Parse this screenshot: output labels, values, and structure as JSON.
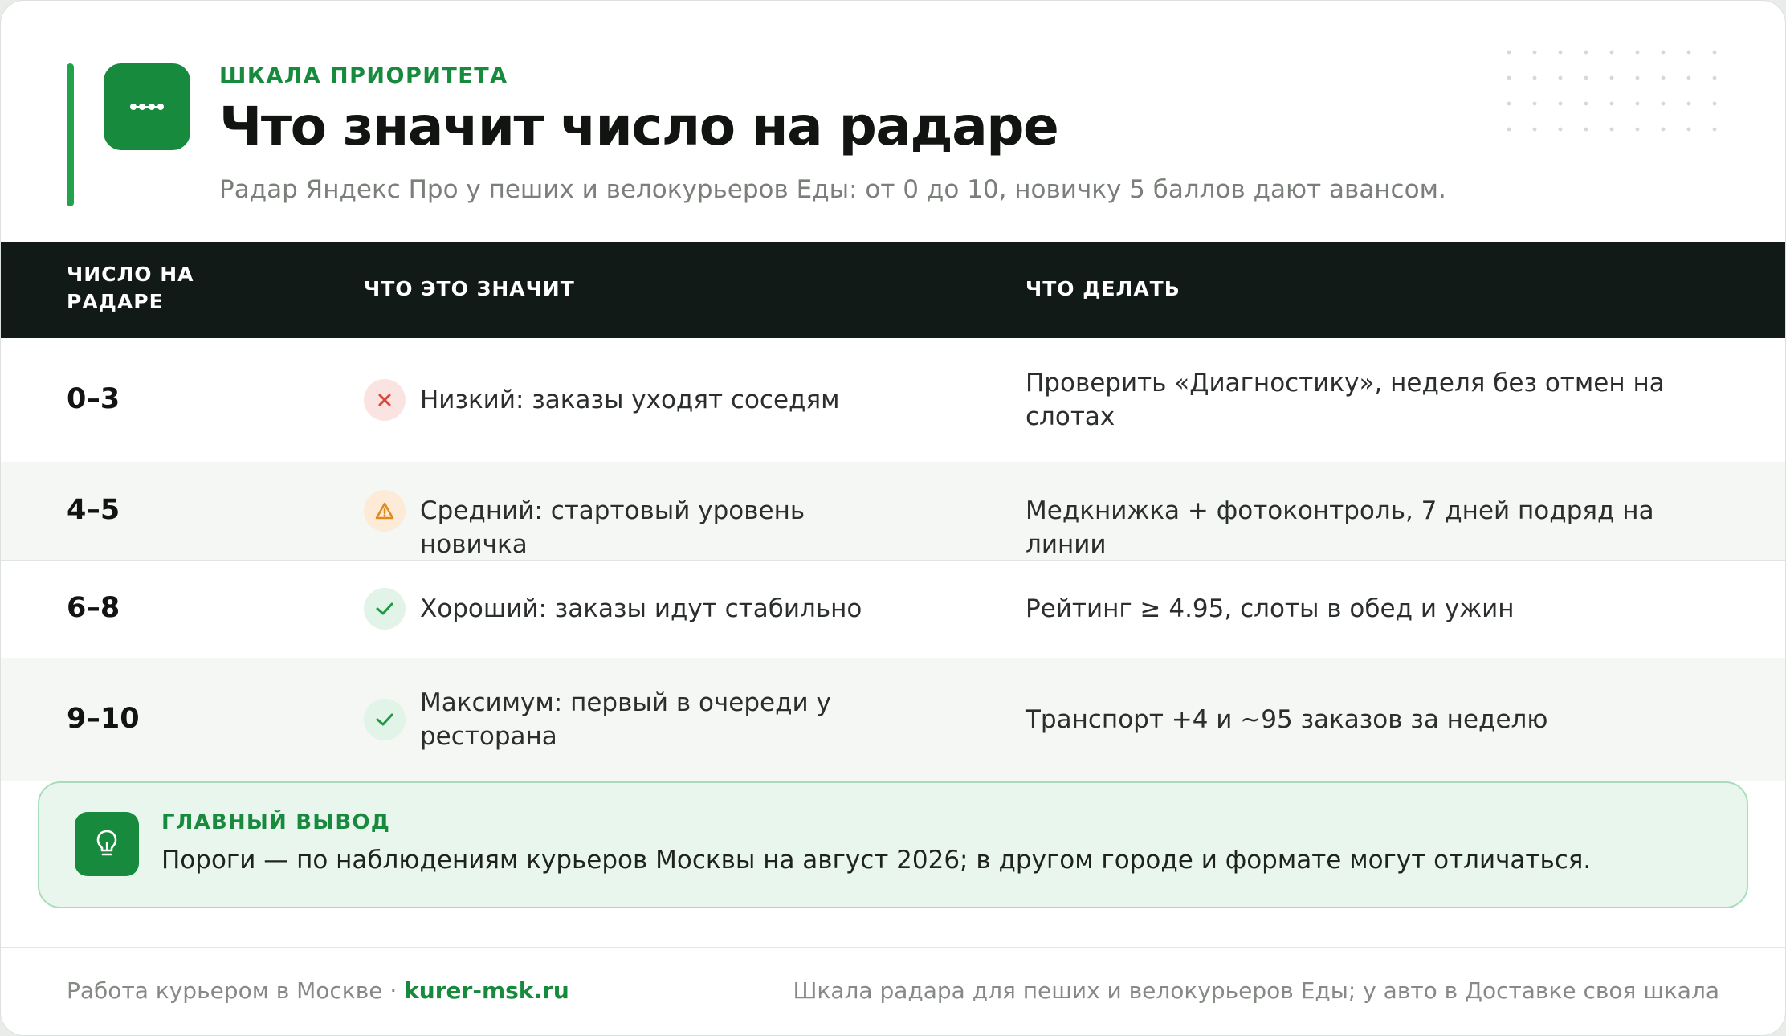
{
  "header": {
    "kicker": "ШКАЛА ПРИОРИТЕТА",
    "title": "Что значит число на радаре",
    "subtitle": "Радар Яндекс Про у пеших и велокурьеров Еды: от 0 до 10, новичку 5 баллов дают авансом.",
    "logo_icon": "slider-dots-icon"
  },
  "table": {
    "columns": [
      "ЧИСЛО НА РАДАРЕ",
      "ЧТО ЭТО ЗНАЧИТ",
      "ЧТО ДЕЛАТЬ"
    ],
    "rows": [
      {
        "range": "0–3",
        "status": "x-icon",
        "status_color": "#d8483b",
        "meaning": "Низкий: заказы уходят соседям",
        "action": "Проверить «Диагностику», неделя без отмен на слотах"
      },
      {
        "range": "4–5",
        "status": "warning-icon",
        "status_color": "#e0891d",
        "meaning": "Средний: стартовый уровень новичка",
        "action": "Медкнижка + фотоконтроль, 7 дней подряд на линии"
      },
      {
        "range": "6–8",
        "status": "check-icon",
        "status_color": "#1f9a47",
        "meaning": "Хороший: заказы идут стабильно",
        "action": "Рейтинг ≥ 4.95, слоты в обед и ужин"
      },
      {
        "range": "9–10",
        "status": "check-icon",
        "status_color": "#1f9a47",
        "meaning": "Максимум: первый в очереди у ресторана",
        "action": "Транспорт +4 и ~95 заказов за неделю"
      }
    ]
  },
  "summary": {
    "icon": "lightbulb-icon",
    "label": "ГЛАВНЫЙ ВЫВОД",
    "text": "Пороги — по наблюдениям курьеров Москвы на август 2026; в другом городе и формате могут отличаться."
  },
  "footer": {
    "left_text": "Работа курьером в Москве · ",
    "site": "kurer-msk.ru",
    "right_text": "Шкала радара для пеших и велокурьеров Еды; у авто в Доставке своя шкала"
  },
  "colors": {
    "accent": "#178a3d",
    "header_bg": "#121a17",
    "alt_row": "#f4f7f4"
  }
}
